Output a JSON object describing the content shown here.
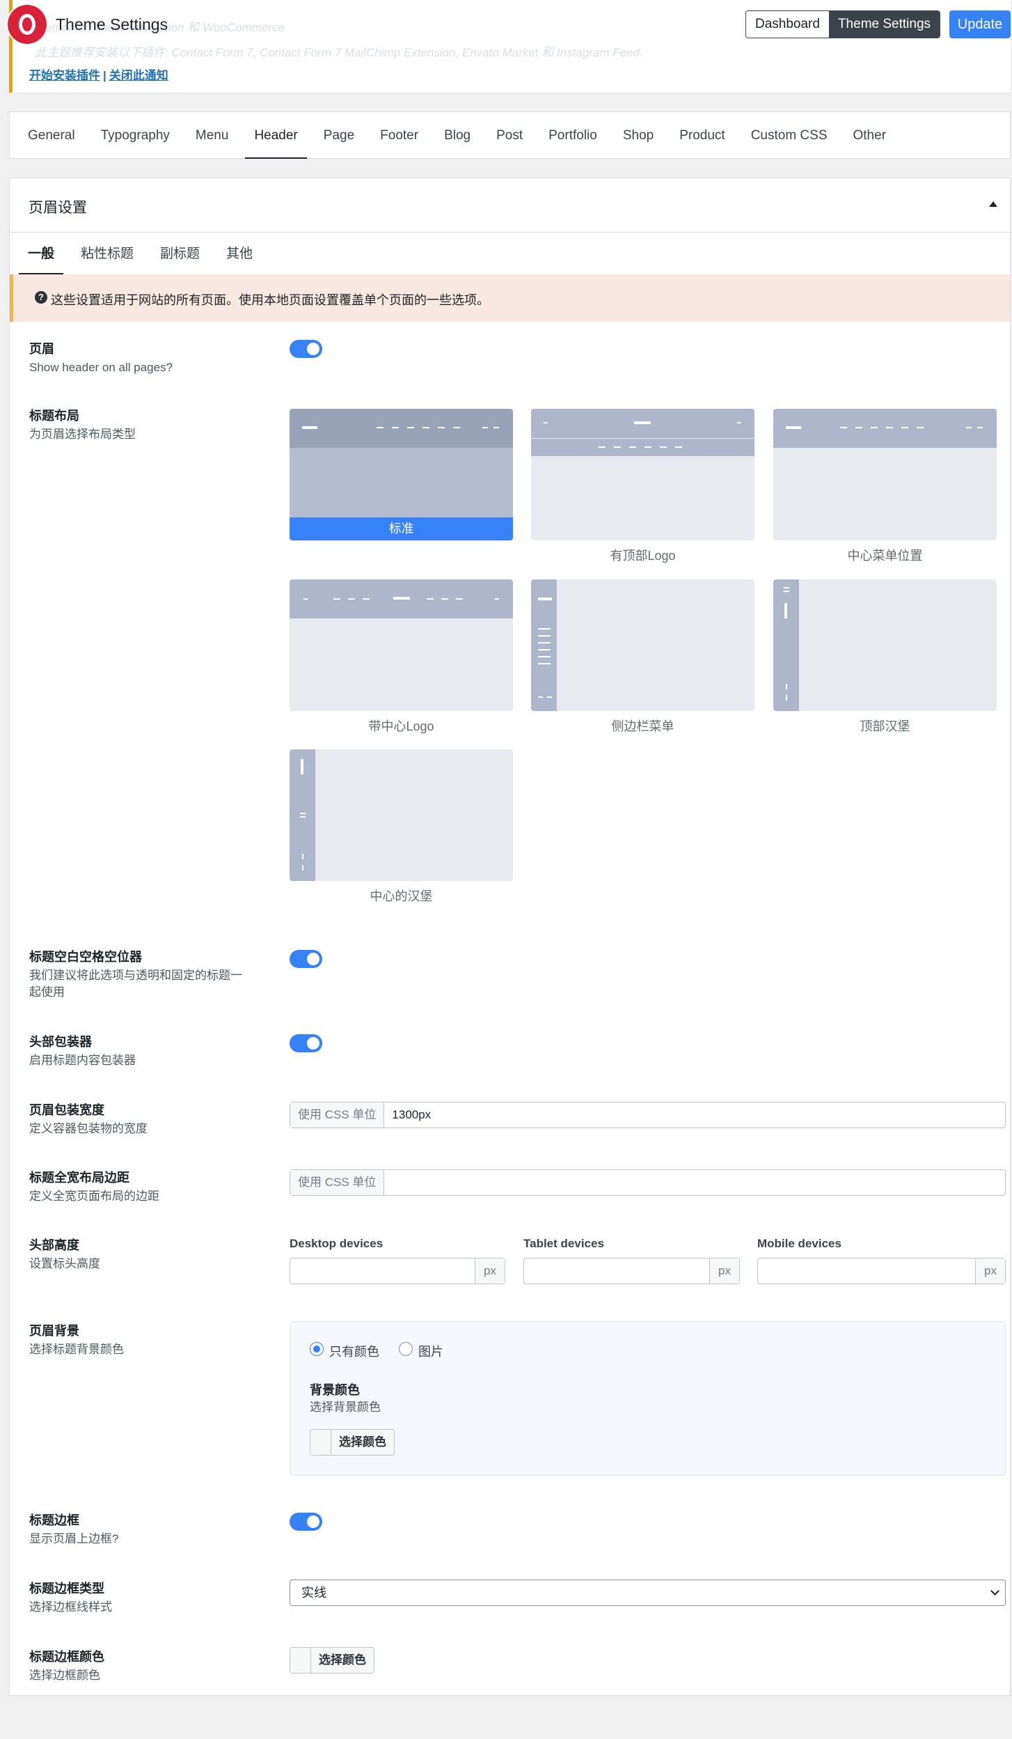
{
  "notice": {
    "line1": "Elementor, Slider Revolution 和 WooCommerce",
    "line2": "此主题推荐安装以下插件: Contact Form 7, Contact Form 7 MailChimp Extension, Envato Market 和 Instagram Feed.",
    "install_link": "开始安装插件",
    "separator": "|",
    "dismiss_link": "关闭此通知"
  },
  "topbar": {
    "app_title": "Theme Settings",
    "dashboard_label": "Dashboard",
    "theme_settings_label": "Theme Settings",
    "update_label": "Update"
  },
  "main_tabs": [
    "General",
    "Typography",
    "Menu",
    "Header",
    "Page",
    "Footer",
    "Blog",
    "Post",
    "Portfolio",
    "Shop",
    "Product",
    "Custom CSS",
    "Other"
  ],
  "active_main_tab": "Header",
  "panel": {
    "title": "页眉设置",
    "sub_tabs": [
      "一般",
      "粘性标题",
      "副标题",
      "其他"
    ],
    "info": "这些设置适用于网站的所有页面。使用本地页面设置覆盖单个页面的一些选项。"
  },
  "settings": {
    "header": {
      "label": "页眉",
      "desc": "Show header on all pages?",
      "enabled": true
    },
    "layout": {
      "label": "标题布局",
      "desc": "为页眉选择布局类型",
      "options": [
        "标准",
        "有顶部Logo",
        "中心菜单位置",
        "带中心Logo",
        "侧边栏菜单",
        "顶部汉堡",
        "中心的汉堡"
      ],
      "selected": "标准"
    },
    "spacer": {
      "label": "标题空白空格空位器",
      "desc": "我们建议将此选项与透明和固定的标题一起使用",
      "enabled": true
    },
    "wrapper": {
      "label": "头部包装器",
      "desc": "启用标题内容包装器",
      "enabled": true
    },
    "wrapper_width": {
      "label": "页眉包装宽度",
      "desc": "定义容器包装物的宽度",
      "addon": "使用 CSS 单位",
      "value": "1300px"
    },
    "fullwidth_padding": {
      "label": "标题全宽布局边距",
      "desc": "定义全宽页面布局的边距",
      "addon": "使用 CSS 单位",
      "value": ""
    },
    "height": {
      "label": "头部高度",
      "desc": "设置标头高度",
      "devices": [
        {
          "name": "Desktop devices",
          "value": "",
          "unit": "px"
        },
        {
          "name": "Tablet devices",
          "value": "",
          "unit": "px"
        },
        {
          "name": "Mobile devices",
          "value": "",
          "unit": "px"
        }
      ]
    },
    "background": {
      "label": "页眉背景",
      "desc": "选择标题背景颜色",
      "radio_color": "只有颜色",
      "radio_image": "图片",
      "selected": "只有颜色",
      "color_label": "背景颜色",
      "color_desc": "选择背景颜色",
      "color_button": "选择颜色"
    },
    "border": {
      "label": "标题边框",
      "desc": "显示页眉上边框?",
      "enabled": true
    },
    "border_type": {
      "label": "标题边框类型",
      "desc": "选择边框线样式",
      "value": "实线"
    },
    "border_color": {
      "label": "标题边框颜色",
      "desc": "选择边框颜色",
      "button": "选择颜色"
    }
  },
  "colors": {
    "accent": "#3582f8",
    "notice_border": "#dba617",
    "info_bg": "#f7e8e1"
  }
}
